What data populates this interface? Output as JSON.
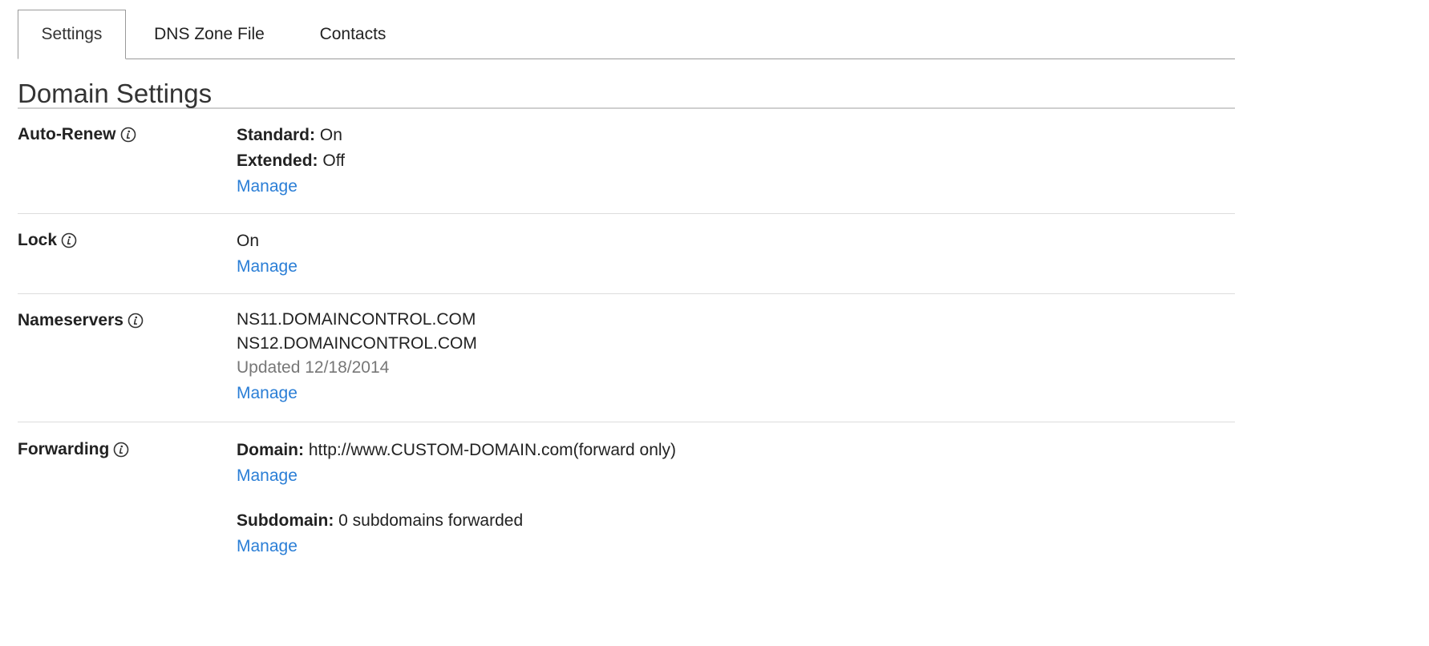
{
  "tabs": [
    {
      "label": "Settings",
      "active": true
    },
    {
      "label": "DNS Zone File",
      "active": false
    },
    {
      "label": "Contacts",
      "active": false
    }
  ],
  "section_title": "Domain Settings",
  "rows": {
    "auto_renew": {
      "label": "Auto-Renew",
      "standard_label": "Standard:",
      "standard_value": "On",
      "extended_label": "Extended:",
      "extended_value": "Off",
      "manage": "Manage"
    },
    "lock": {
      "label": "Lock",
      "value": "On",
      "manage": "Manage"
    },
    "nameservers": {
      "label": "Nameservers",
      "ns1": "NS11.DOMAINCONTROL.COM",
      "ns2": "NS12.DOMAINCONTROL.COM",
      "updated": "Updated 12/18/2014",
      "manage": "Manage"
    },
    "forwarding": {
      "label": "Forwarding",
      "domain_label": "Domain:",
      "domain_value": "http://www.CUSTOM-DOMAIN.com(forward only)",
      "domain_manage": "Manage",
      "subdomain_label": "Subdomain:",
      "subdomain_value": "0 subdomains forwarded",
      "subdomain_manage": "Manage"
    }
  },
  "colors": {
    "link": "#2a7ed6",
    "muted": "#777777",
    "text": "#222222",
    "border": "#dddddd"
  },
  "icons": {
    "info": "info-circle-icon"
  }
}
